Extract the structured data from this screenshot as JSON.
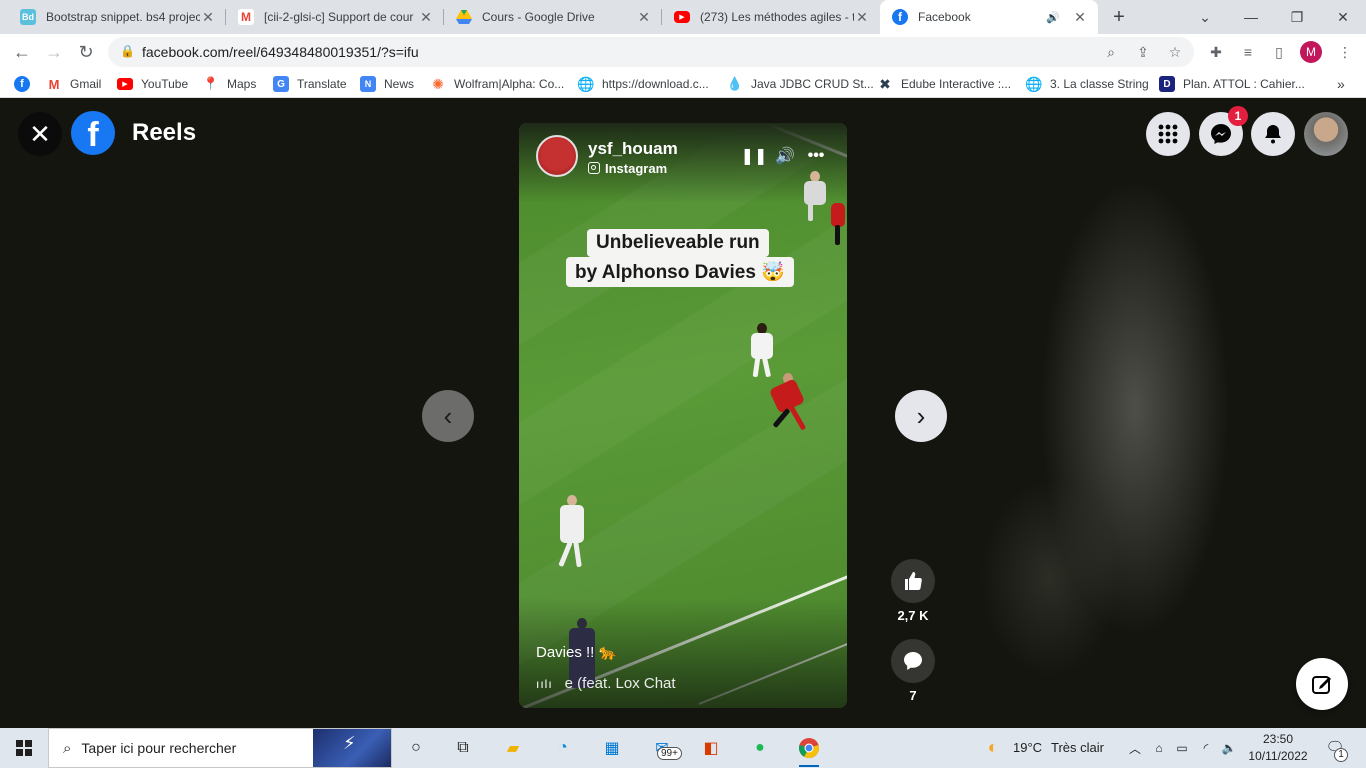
{
  "browser": {
    "tabs": [
      {
        "title": "Bootstrap snippet. bs4 projec",
        "icon": "bootdey-icon",
        "color": "#5bc0de"
      },
      {
        "title": "[cii-2-glsi-c] Support de cour",
        "icon": "gmail-icon",
        "color": "#ea4335"
      },
      {
        "title": "Cours - Google Drive",
        "icon": "google-drive-icon",
        "color": "#1fa463"
      },
      {
        "title": "(273) Les méthodes agiles - t",
        "icon": "youtube-icon",
        "color": "#ff0000"
      },
      {
        "title": "Facebook",
        "icon": "facebook-icon",
        "color": "#1877f2",
        "active": true
      }
    ],
    "new_tab_label": "+",
    "url": "facebook.com/reel/649348480019351/?s=ifu",
    "profile_initial": "M",
    "bookmarks": [
      {
        "label": "",
        "icon": "facebook-icon"
      },
      {
        "label": "Gmail",
        "icon": "gmail-icon"
      },
      {
        "label": "YouTube",
        "icon": "youtube-icon"
      },
      {
        "label": "Maps",
        "icon": "maps-icon"
      },
      {
        "label": "Translate",
        "icon": "translate-icon"
      },
      {
        "label": "News",
        "icon": "news-icon"
      },
      {
        "label": "Wolfram|Alpha: Co...",
        "icon": "wolfram-icon"
      },
      {
        "label": "https://download.c...",
        "icon": "globe-icon"
      },
      {
        "label": "Java JDBC CRUD St...",
        "icon": "java-icon"
      },
      {
        "label": "Edube Interactive :...",
        "icon": "edube-icon"
      },
      {
        "label": "3. La classe String",
        "icon": "globe-icon"
      },
      {
        "label": "Plan. ATTOL : Cahier...",
        "icon": "d-icon"
      }
    ],
    "bookmarks_overflow": "»"
  },
  "reels": {
    "title": "Reels",
    "uploader": {
      "name": "ysf_houam",
      "source": "Instagram"
    },
    "overlay_text_line1": "Unbelieveable run",
    "overlay_text_line2": "by Alphonso Davies 🤯",
    "description": "Davies !! 🐆",
    "music": "e (feat. Lox Chat",
    "likes": "2,7 K",
    "comments": "7",
    "messenger_badge": "1"
  },
  "taskbar": {
    "search_placeholder": "Taper ici pour rechercher",
    "mail_badge": "99+",
    "weather_temp": "19°C",
    "weather_desc": "Très clair",
    "time": "23:50",
    "date": "10/11/2022",
    "notification_count": "1"
  }
}
